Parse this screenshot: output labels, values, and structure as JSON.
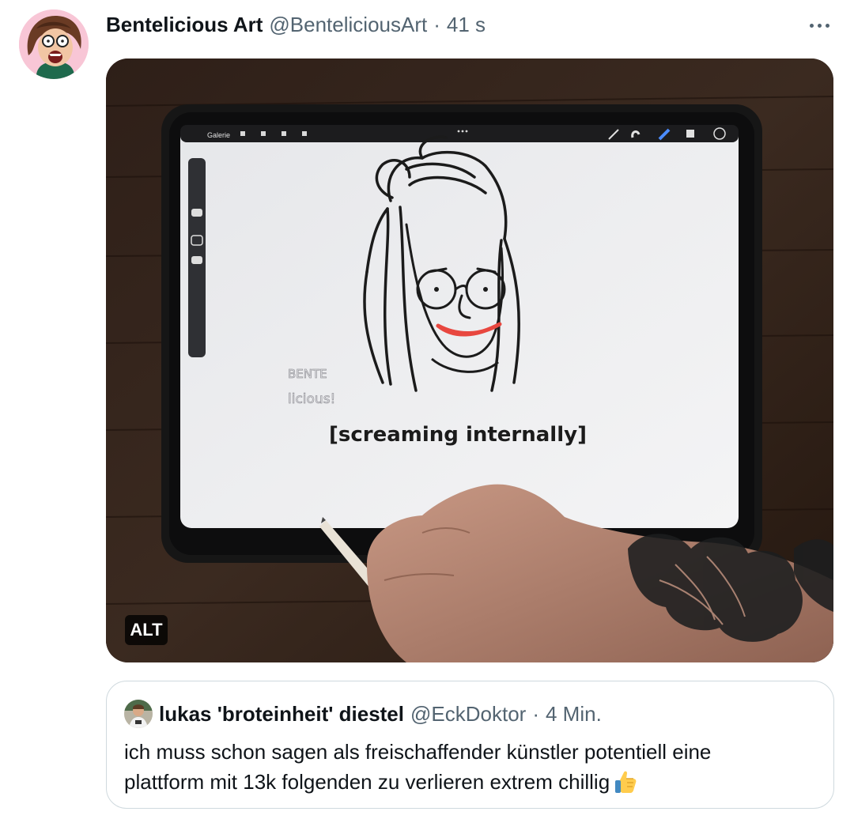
{
  "tweet": {
    "author": {
      "display_name": "Bentelicious Art",
      "handle": "@BenteliciousArt",
      "avatar_icon": "cartoon-screaming-woman-avatar"
    },
    "separator": "·",
    "time": "41 s",
    "more_icon": "more-horizontal-icon",
    "media": {
      "alt_badge": "ALT",
      "app_menu_label": "Galerie",
      "drawing_caption": "[screaming internally]",
      "watermark_lines": [
        "BENTE",
        "licious!"
      ],
      "accent_color": "#e8473f"
    }
  },
  "quote": {
    "author": {
      "display_name": "lukas 'broteinheit' diestel",
      "handle": "@EckDoktor"
    },
    "separator": "·",
    "time": "4 Min.",
    "text_line_1": "ich muss schon sagen als freischaffender künstler potentiell eine",
    "text_line_2": "plattform mit 13k folgenden zu verlieren extrem chillig",
    "emoji_icon": "thumbs-up-emoji"
  },
  "colors": {
    "text_primary": "#0f1419",
    "text_secondary": "#536471",
    "border": "#cfd9de"
  }
}
